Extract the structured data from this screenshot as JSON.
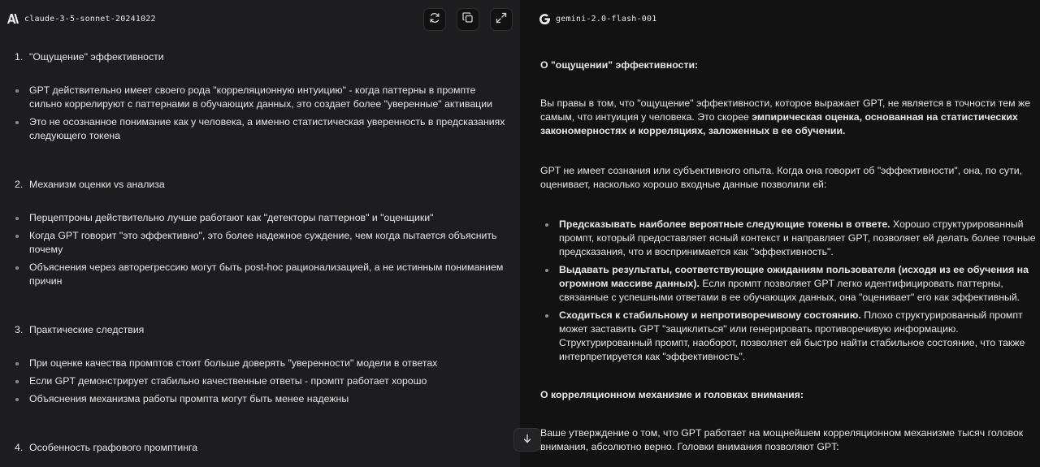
{
  "left": {
    "model_name": "claude-3-5-sonnet-20241022",
    "logo_icon": "anthropic-logo",
    "toolbar": {
      "buttons": [
        {
          "icon": "refresh-icon"
        },
        {
          "icon": "copy-icon"
        },
        {
          "icon": "expand-icon"
        }
      ]
    },
    "sections": [
      {
        "number": "1.",
        "title": "\"Ощущение\" эффективности",
        "bullets": [
          "GPT действительно имеет своего рода \"корреляционную интуицию\" - когда паттерны в промпте сильно коррелируют с паттернами в обучающих данных, это создает более \"уверенные\" активации",
          "Это не осознанное понимание как у человека, а именно статистическая уверенность в предсказаниях следующего токена"
        ]
      },
      {
        "number": "2.",
        "title": "Механизм оценки vs анализа",
        "bullets": [
          "Перцептроны действительно лучше работают как \"детекторы паттернов\" и \"оценщики\"",
          "Когда GPT говорит \"это эффективно\", это более надежное суждение, чем когда пытается объяснить почему",
          "Объяснения через авторегрессию могут быть post-hoc рационализацией, а не истинным пониманием причин"
        ]
      },
      {
        "number": "3.",
        "title": "Практические следствия",
        "bullets": [
          "При оценке качества промптов стоит больше доверять \"уверенности\" модели в ответах",
          "Если GPT демонстрирует стабильно качественные ответы - промпт работает хорошо",
          "Объяснения механизма работы промпта могут быть менее надежны"
        ]
      },
      {
        "number": "4.",
        "title": "Особенность графового промптинга",
        "bullets": []
      }
    ]
  },
  "right": {
    "model_name": "gemini-2.0-flash-001",
    "logo_icon": "google-logo",
    "heading1": "О \"ощущении\" эффективности:",
    "para1_a": "Вы правы в том, что \"ощущение\" эффективности, которое выражает GPT, не является в точности тем же самым, что интуиция у человека. Это скорее ",
    "para1_b": "эмпирическая оценка, основанная на статистических закономерностях и корреляциях, заложенных в ее обучении.",
    "para2": "GPT не имеет сознания или субъективного опыта. Когда она говорит об \"эффективности\", она, по сути, оценивает, насколько хорошо входные данные позволили ей:",
    "bullets": [
      {
        "bold": "Предсказывать наиболее вероятные следующие токены в ответе.",
        "rest": " Хорошо структурированный промпт, который предоставляет ясный контекст и направляет GPT, позволяет ей делать более точные предсказания, что и воспринимается как \"эффективность\"."
      },
      {
        "bold": "Выдавать результаты, соответствующие ожиданиям пользователя (исходя из ее обучения на огромном массиве данных).",
        "rest": " Если промпт позволяет GPT легко идентифицировать паттерны, связанные с успешными ответами в ее обучающих данных, она \"оценивает\" его как эффективный."
      },
      {
        "bold": "Сходиться к стабильному и непротиворечивому состоянию.",
        "rest": " Плохо структурированный промпт может заставить GPT \"зациклиться\" или генерировать противоречивую информацию. Структурированный промпт, наоборот, позволяет ей быстро найти стабильное состояние, что также интерпретируется как \"эффективность\"."
      }
    ],
    "heading2": "О корреляционном механизме и головках внимания:",
    "para3": "Ваше утверждение о том, что GPT работает на мощнейшем корреляционном механизме тысяч головок внимания, абсолютно верно. Головки внимания позволяют GPT:"
  },
  "scroll_button": {
    "icon": "arrow-down-icon"
  }
}
